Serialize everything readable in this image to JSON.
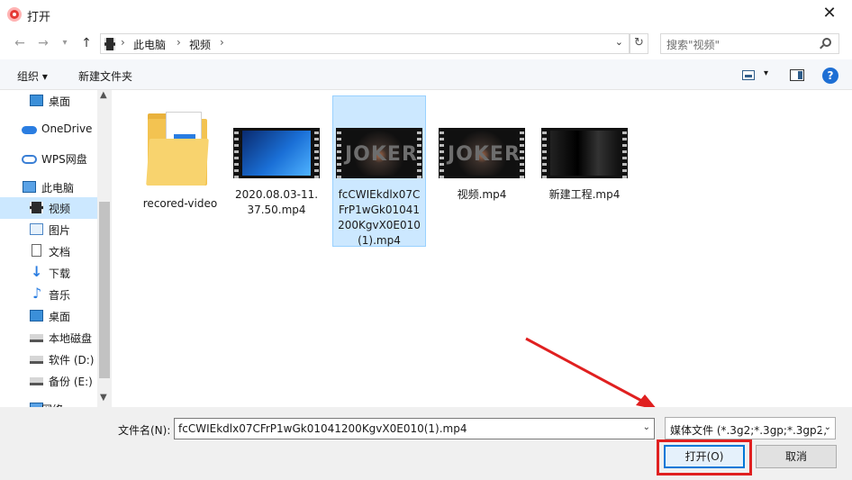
{
  "window": {
    "title": "打开"
  },
  "address": {
    "crumbs": [
      "此电脑",
      "视频"
    ],
    "separator": "›"
  },
  "search": {
    "placeholder": "搜索\"视频\""
  },
  "toolbar": {
    "organize": "组织 ▾",
    "new_folder": "新建文件夹"
  },
  "sidebar": {
    "items": [
      {
        "label": "桌面",
        "icon": "desktop-icon"
      },
      {
        "label": "OneDrive",
        "icon": "cloud-icon"
      },
      {
        "label": "WPS网盘",
        "icon": "wps-cloud-icon"
      },
      {
        "label": "此电脑",
        "icon": "computer-icon"
      },
      {
        "label": "视频",
        "icon": "video-folder-icon",
        "selected": true
      },
      {
        "label": "图片",
        "icon": "pictures-icon"
      },
      {
        "label": "文档",
        "icon": "documents-icon"
      },
      {
        "label": "下载",
        "icon": "download-icon"
      },
      {
        "label": "音乐",
        "icon": "music-icon"
      },
      {
        "label": "桌面",
        "icon": "desktop-icon"
      },
      {
        "label": "本地磁盘",
        "icon": "disk-icon"
      },
      {
        "label": "软件 (D:)",
        "icon": "disk-icon"
      },
      {
        "label": "备份 (E:)",
        "icon": "disk-icon"
      },
      {
        "label": "网络",
        "icon": "network-icon"
      }
    ]
  },
  "files": [
    {
      "name": "recored-video",
      "kind": "folder"
    },
    {
      "name": "2020.08.03-11.37.50.mp4",
      "kind": "video-windows"
    },
    {
      "name": "fcCWIEkdlx07CFrP1wGk01041200KgvX0E010(1).mp4",
      "kind": "video-joker",
      "selected": true
    },
    {
      "name": "视频.mp4",
      "kind": "video-joker"
    },
    {
      "name": "新建工程.mp4",
      "kind": "video-dark"
    }
  ],
  "thumb_text": {
    "joker": "JOKER"
  },
  "footer": {
    "filename_label": "文件名(N):",
    "filename_value": "fcCWIEkdlx07CFrP1wGk01041200KgvX0E010(1).mp4",
    "filetype_value": "媒体文件 (*.3g2;*.3gp;*.3gp2;",
    "open_label": "打开(O)",
    "cancel_label": "取消"
  },
  "colors": {
    "selection": "#cce8ff",
    "accent": "#0078d7",
    "annotation": "#e02020"
  }
}
